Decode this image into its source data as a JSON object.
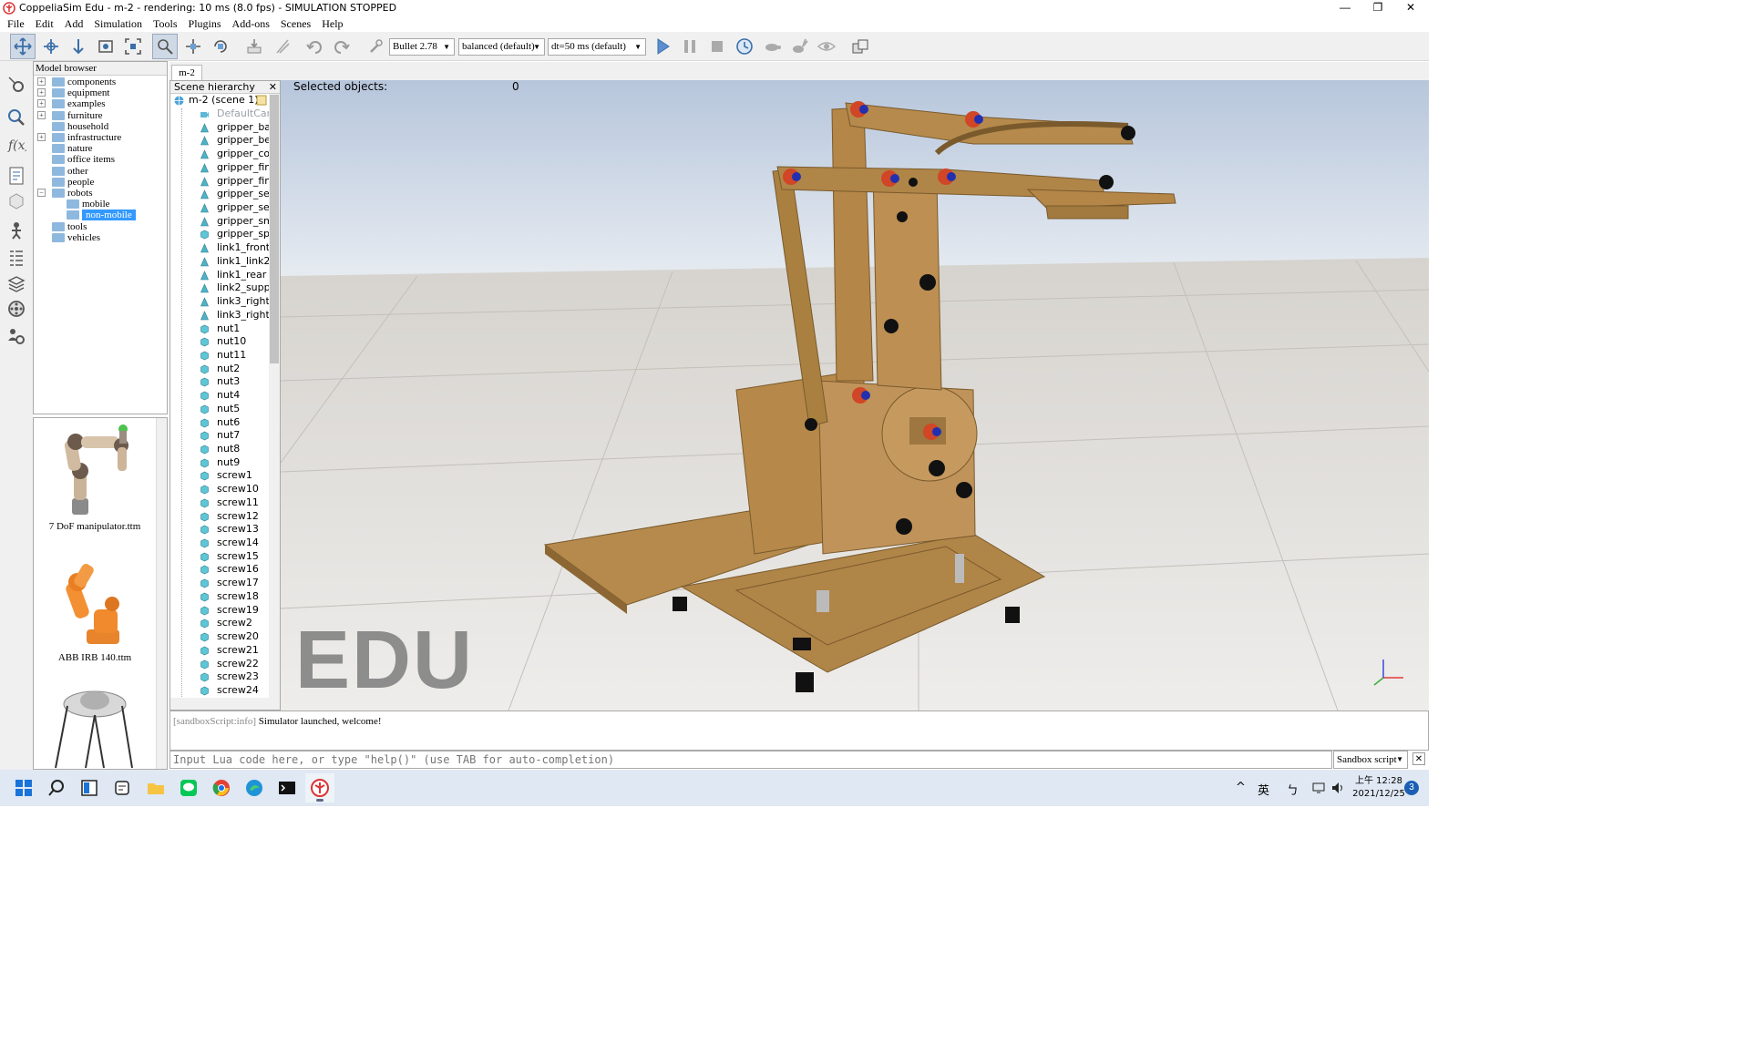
{
  "window": {
    "title": "CoppeliaSim Edu - m-2 - rendering: 10 ms (8.0 fps) - SIMULATION STOPPED",
    "minimize": "—",
    "restore": "❐",
    "close": "✕"
  },
  "menu": [
    "File",
    "Edit",
    "Add",
    "Simulation",
    "Tools",
    "Plugins",
    "Add-ons",
    "Scenes",
    "Help"
  ],
  "toolbar": {
    "engine": "Bullet 2.78",
    "mode": "balanced (default)",
    "dt": "dt=50 ms (default)"
  },
  "model_browser": {
    "header": "Model browser",
    "items": [
      {
        "label": "components",
        "expand": "+"
      },
      {
        "label": "equipment",
        "expand": "+"
      },
      {
        "label": "examples",
        "expand": "+"
      },
      {
        "label": "furniture",
        "expand": "+"
      },
      {
        "label": "household",
        "expand": ""
      },
      {
        "label": "infrastructure",
        "expand": "+"
      },
      {
        "label": "nature",
        "expand": ""
      },
      {
        "label": "office items",
        "expand": ""
      },
      {
        "label": "other",
        "expand": ""
      },
      {
        "label": "people",
        "expand": ""
      },
      {
        "label": "robots",
        "expand": "−"
      },
      {
        "label": "mobile",
        "expand": ""
      },
      {
        "label": "non-mobile",
        "expand": ""
      },
      {
        "label": "tools",
        "expand": ""
      },
      {
        "label": "vehicles",
        "expand": ""
      }
    ],
    "thumbnails": [
      "7 DoF manipulator.ttm",
      "ABB IRB 140.ttm"
    ]
  },
  "doc_tab": "m-2",
  "scene_hierarchy": {
    "header": "Scene hierarchy",
    "close": "✕",
    "root": "m-2 (scene 1)",
    "items": [
      "DefaultCam",
      "gripper_ba",
      "gripper_be",
      "gripper_co",
      "gripper_fing",
      "gripper_fing",
      "gripper_ser",
      "gripper_ser",
      "gripper_sm",
      "gripper_spa",
      "link1_front",
      "link1_link2_",
      "link1_rear",
      "link2_suppo",
      "link3_right_",
      "link3_right_",
      "nut1",
      "nut10",
      "nut11",
      "nut2",
      "nut3",
      "nut4",
      "nut5",
      "nut6",
      "nut7",
      "nut8",
      "nut9",
      "screw1",
      "screw10",
      "screw11",
      "screw12",
      "screw13",
      "screw14",
      "screw15",
      "screw16",
      "screw17",
      "screw18",
      "screw19",
      "screw2",
      "screw20",
      "screw21",
      "screw22",
      "screw23",
      "screw24"
    ]
  },
  "viewport": {
    "selected_label": "Selected objects:",
    "selected_count": "0",
    "watermark": "EDU"
  },
  "console": {
    "tag": "[sandboxScript:info]",
    "message": "Simulator launched, welcome!",
    "input_placeholder": "Input Lua code here, or type \"help()\" (use TAB for auto-completion)",
    "script_select": "Sandbox script",
    "close": "✕"
  },
  "taskbar": {
    "tray_ime": "英",
    "tray_ime2": "ㄅ",
    "time": "上午 12:28",
    "date": "2021/12/25",
    "notifications": "3"
  },
  "colors": {
    "wood": "#b4884a",
    "wood_dark": "#8f6a37",
    "selection": "#3399ff",
    "sky": "#c7d3e2"
  }
}
